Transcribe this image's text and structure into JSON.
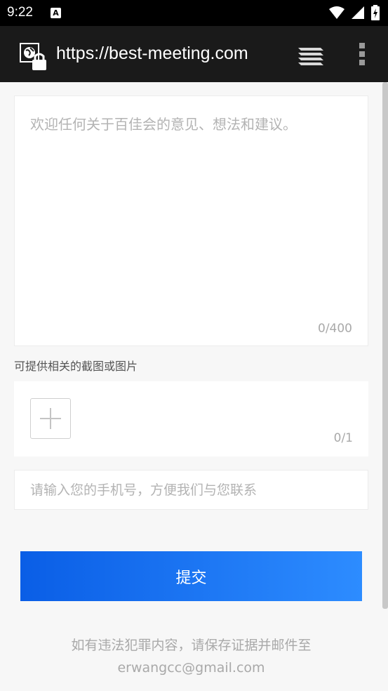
{
  "status_bar": {
    "time": "9:22",
    "notification_icon_letter": "A",
    "icons": [
      "wifi-icon",
      "signal-icon",
      "battery-charging-icon"
    ]
  },
  "browser": {
    "url": "https://best-meeting.com",
    "icons": [
      "site-secure-icon",
      "tabs-icon",
      "overflow-menu-icon"
    ]
  },
  "feedback": {
    "placeholder": "欢迎任何关于百佳会的意见、想法和建议。",
    "counter": "0/400"
  },
  "upload": {
    "label": "可提供相关的截图或图片",
    "counter": "0/1",
    "icon": "plus-icon"
  },
  "phone": {
    "placeholder": "请输入您的手机号，方便我们与您联系"
  },
  "submit": {
    "label": "提交"
  },
  "footer": {
    "line1": "如有违法犯罪内容，请保存证据并邮件至",
    "line2": "erwangcc@gmail.com"
  },
  "colors": {
    "status_bar_bg": "#000000",
    "toolbar_bg": "#1a1a1a",
    "page_bg": "#f7f7f7",
    "button_gradient_start": "#0a5ee6",
    "button_gradient_end": "#2d8cff",
    "placeholder": "#b3b3b3",
    "muted_text": "#a9a9a9"
  }
}
